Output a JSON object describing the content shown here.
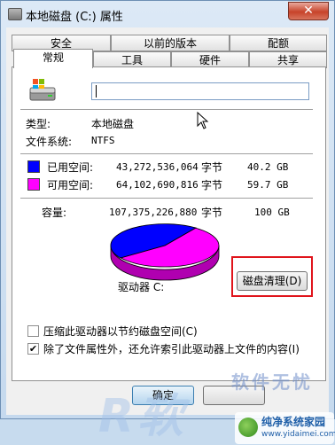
{
  "window": {
    "title": "本地磁盘 (C:) 属性",
    "close_label": "✕"
  },
  "tabs": {
    "row_back": [
      "安全",
      "以前的版本",
      "配额"
    ],
    "row_front": [
      "常规",
      "工具",
      "硬件",
      "共享"
    ],
    "active": "常规"
  },
  "general": {
    "name_value": "",
    "type_label": "类型:",
    "type_value": "本地磁盘",
    "fs_label": "文件系统:",
    "fs_value": "NTFS",
    "used": {
      "label": "已用空间:",
      "bytes": "43,272,536,064",
      "unit": "字节",
      "size": "40.2 GB",
      "color": "#0000ff"
    },
    "free": {
      "label": "可用空间:",
      "bytes": "64,102,690,816",
      "unit": "字节",
      "size": "59.7 GB",
      "color": "#ff00ff"
    },
    "capacity": {
      "label": "容量:",
      "bytes": "107,375,226,880",
      "unit": "字节",
      "size": "100 GB"
    },
    "drive_label": "驱动器 C:",
    "cleanup_button": "磁盘清理(D)",
    "compress_label": "压缩此驱动器以节约磁盘空间(C)",
    "compress_checked": false,
    "index_label": "除了文件属性外，还允许索引此驱动器上文件的内容(I)",
    "index_checked": true
  },
  "buttons": {
    "ok": "确定"
  },
  "watermark": {
    "top": "软件无忧",
    "big": "R软",
    "badge_cn": "纯净系统家园",
    "badge_url": "www.yidaimei.com"
  },
  "icons": [
    "drive-icon",
    "mouse-cursor-icon",
    "close-icon"
  ]
}
